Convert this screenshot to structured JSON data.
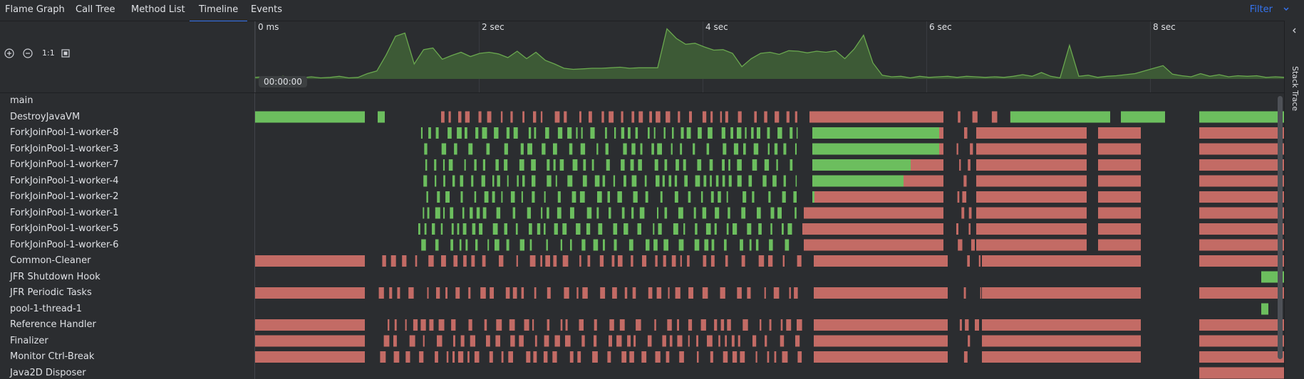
{
  "tabs": [
    {
      "label": "Flame Graph",
      "active": false
    },
    {
      "label": "Call Tree",
      "active": false
    },
    {
      "label": "Method List",
      "active": false
    },
    {
      "label": "Timeline",
      "active": true
    },
    {
      "label": "Events",
      "active": false
    }
  ],
  "filter_label": "Filter",
  "toolbar": {
    "zoom_in_icon": "zoom-in-icon",
    "zoom_out_icon": "zoom-out-icon",
    "actual_size_label": "1:1",
    "fit_icon": "fit-icon"
  },
  "overview": {
    "tick_labels": [
      "0 ms",
      "2 sec",
      "4 sec",
      "6 sec",
      "8 sec"
    ],
    "current_time": "00:00:00",
    "activity": [
      0.03,
      0.04,
      0.02,
      0.05,
      0.01,
      0.02,
      0.04,
      0.02,
      0.03,
      0.05,
      0.02,
      0.03,
      0.1,
      0.15,
      0.45,
      0.8,
      0.86,
      0.28,
      0.55,
      0.58,
      0.37,
      0.44,
      0.5,
      0.42,
      0.48,
      0.5,
      0.47,
      0.4,
      0.52,
      0.38,
      0.5,
      0.35,
      0.28,
      0.2,
      0.18,
      0.19,
      0.2,
      0.2,
      0.21,
      0.22,
      0.2,
      0.21,
      0.21,
      0.21,
      0.94,
      0.76,
      0.65,
      0.67,
      0.6,
      0.54,
      0.55,
      0.48,
      0.23,
      0.38,
      0.48,
      0.5,
      0.46,
      0.53,
      0.52,
      0.49,
      0.52,
      0.5,
      0.53,
      0.38,
      0.56,
      0.82,
      0.3,
      0.07,
      0.04,
      0.05,
      0.02,
      0.05,
      0.03,
      0.04,
      0.05,
      0.03,
      0.05,
      0.04,
      0.03,
      0.04,
      0.03,
      0.05,
      0.08,
      0.05,
      0.12,
      0.05,
      0.02,
      0.63,
      0.05,
      0.07,
      0.03,
      0.05,
      0.06,
      0.08,
      0.1,
      0.15,
      0.2,
      0.25,
      0.09,
      0.06,
      0.04,
      0.1,
      0.05,
      0.08,
      0.04,
      0.06,
      0.05,
      0.06,
      0.03,
      0.04,
      0.03
    ],
    "colors": {
      "fill": "#3d5a36",
      "line": "#6aa84f"
    }
  },
  "threads": [
    "main",
    "DestroyJavaVM",
    "ForkJoinPool-1-worker-8",
    "ForkJoinPool-1-worker-3",
    "ForkJoinPool-1-worker-7",
    "ForkJoinPool-1-worker-4",
    "ForkJoinPool-1-worker-2",
    "ForkJoinPool-1-worker-1",
    "ForkJoinPool-1-worker-5",
    "ForkJoinPool-1-worker-6",
    "Common-Cleaner",
    "JFR Shutdown Hook",
    "JFR Periodic Tasks",
    "pool-1-thread-1",
    "Reference Handler",
    "Finalizer",
    "Monitor Ctrl-Break",
    "Java2D Disposer"
  ],
  "state_colors": {
    "running": "#6cbe5e",
    "waiting": "#c36b65"
  },
  "side_panel": {
    "label": "Stack Trace"
  }
}
